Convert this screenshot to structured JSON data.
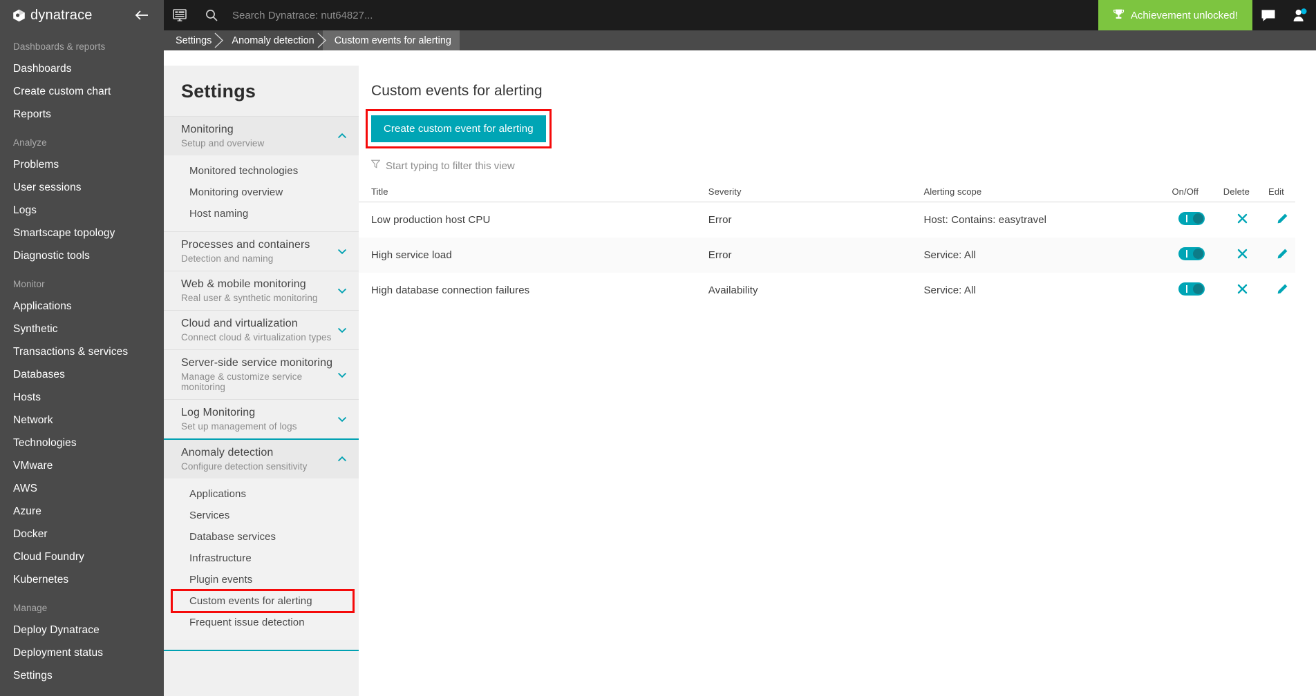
{
  "brand": {
    "name": "dynatrace",
    "collapse_icon": "arrow-left-icon"
  },
  "topbar": {
    "dashboard_icon": "dashboard-grid-icon",
    "search_icon": "search-icon",
    "search_placeholder": "Search Dynatrace: nut64827...",
    "search_value": "",
    "achievement_label": "Achievement unlocked!",
    "achievement_icon": "trophy-icon",
    "achievement_color": "#7dc540",
    "chat_icon": "chat-bubble-icon",
    "user_icon": "user-avatar-icon"
  },
  "breadcrumb": [
    {
      "label": "Settings",
      "active": false
    },
    {
      "label": "Anomaly detection",
      "active": false
    },
    {
      "label": "Custom events for alerting",
      "active": true
    }
  ],
  "left_nav": {
    "groups": [
      {
        "label": "Dashboards & reports",
        "items": [
          "Dashboards",
          "Create custom chart",
          "Reports"
        ]
      },
      {
        "label": "Analyze",
        "items": [
          "Problems",
          "User sessions",
          "Logs",
          "Smartscape topology",
          "Diagnostic tools"
        ]
      },
      {
        "label": "Monitor",
        "items": [
          "Applications",
          "Synthetic",
          "Transactions & services",
          "Databases",
          "Hosts",
          "Network",
          "Technologies",
          "VMware",
          "AWS",
          "Azure",
          "Docker",
          "Cloud Foundry",
          "Kubernetes"
        ]
      },
      {
        "label": "Manage",
        "items": [
          "Deploy Dynatrace",
          "Deployment status",
          "Settings"
        ]
      }
    ]
  },
  "settings_panel": {
    "title": "Settings",
    "sections": [
      {
        "title": "Monitoring",
        "subtitle": "Setup and overview",
        "expanded": true,
        "accent": false,
        "caret": "chevron-up-icon",
        "children": [
          "Monitored technologies",
          "Monitoring overview",
          "Host naming"
        ]
      },
      {
        "title": "Processes and containers",
        "subtitle": "Detection and naming",
        "expanded": false,
        "accent": false,
        "caret": "chevron-down-icon",
        "children": []
      },
      {
        "title": "Web & mobile monitoring",
        "subtitle": "Real user & synthetic monitoring",
        "expanded": false,
        "accent": false,
        "caret": "chevron-down-icon",
        "children": []
      },
      {
        "title": "Cloud and virtualization",
        "subtitle": "Connect cloud & virtualization types",
        "expanded": false,
        "accent": false,
        "caret": "chevron-down-icon",
        "children": []
      },
      {
        "title": "Server-side service monitoring",
        "subtitle": "Manage & customize service monitoring",
        "expanded": false,
        "accent": false,
        "caret": "chevron-down-icon",
        "children": []
      },
      {
        "title": "Log Monitoring",
        "subtitle": "Set up management of logs",
        "expanded": false,
        "accent": false,
        "caret": "chevron-down-icon",
        "children": []
      },
      {
        "title": "Anomaly detection",
        "subtitle": "Configure detection sensitivity",
        "expanded": true,
        "accent": true,
        "caret": "chevron-up-icon",
        "children": [
          "Applications",
          "Services",
          "Database services",
          "Infrastructure",
          "Plugin events",
          "Custom events for alerting",
          "Frequent issue detection"
        ],
        "highlighted_child": "Custom events for alerting"
      }
    ],
    "accent_color": "#00a1b2",
    "highlight_color": "#f50a0a"
  },
  "main": {
    "title": "Custom events for alerting",
    "create_button": "Create custom event for alerting",
    "create_button_color": "#00a5b5",
    "filter_icon": "filter-funnel-icon",
    "filter_placeholder": "Start typing to filter this view",
    "filter_value": "",
    "table": {
      "columns": [
        "Title",
        "Severity",
        "Alerting scope",
        "On/Off",
        "Delete",
        "Edit"
      ],
      "rows": [
        {
          "title": "Low production host CPU",
          "severity": "Error",
          "scope": "Host: Contains: easytravel",
          "enabled": true,
          "delete_icon": "close-x-icon",
          "edit_icon": "pencil-icon"
        },
        {
          "title": "High service load",
          "severity": "Error",
          "scope": "Service: All",
          "enabled": true,
          "delete_icon": "close-x-icon",
          "edit_icon": "pencil-icon"
        },
        {
          "title": "High database connection failures",
          "severity": "Availability",
          "scope": "Service: All",
          "enabled": true,
          "delete_icon": "close-x-icon",
          "edit_icon": "pencil-icon"
        }
      ]
    }
  }
}
